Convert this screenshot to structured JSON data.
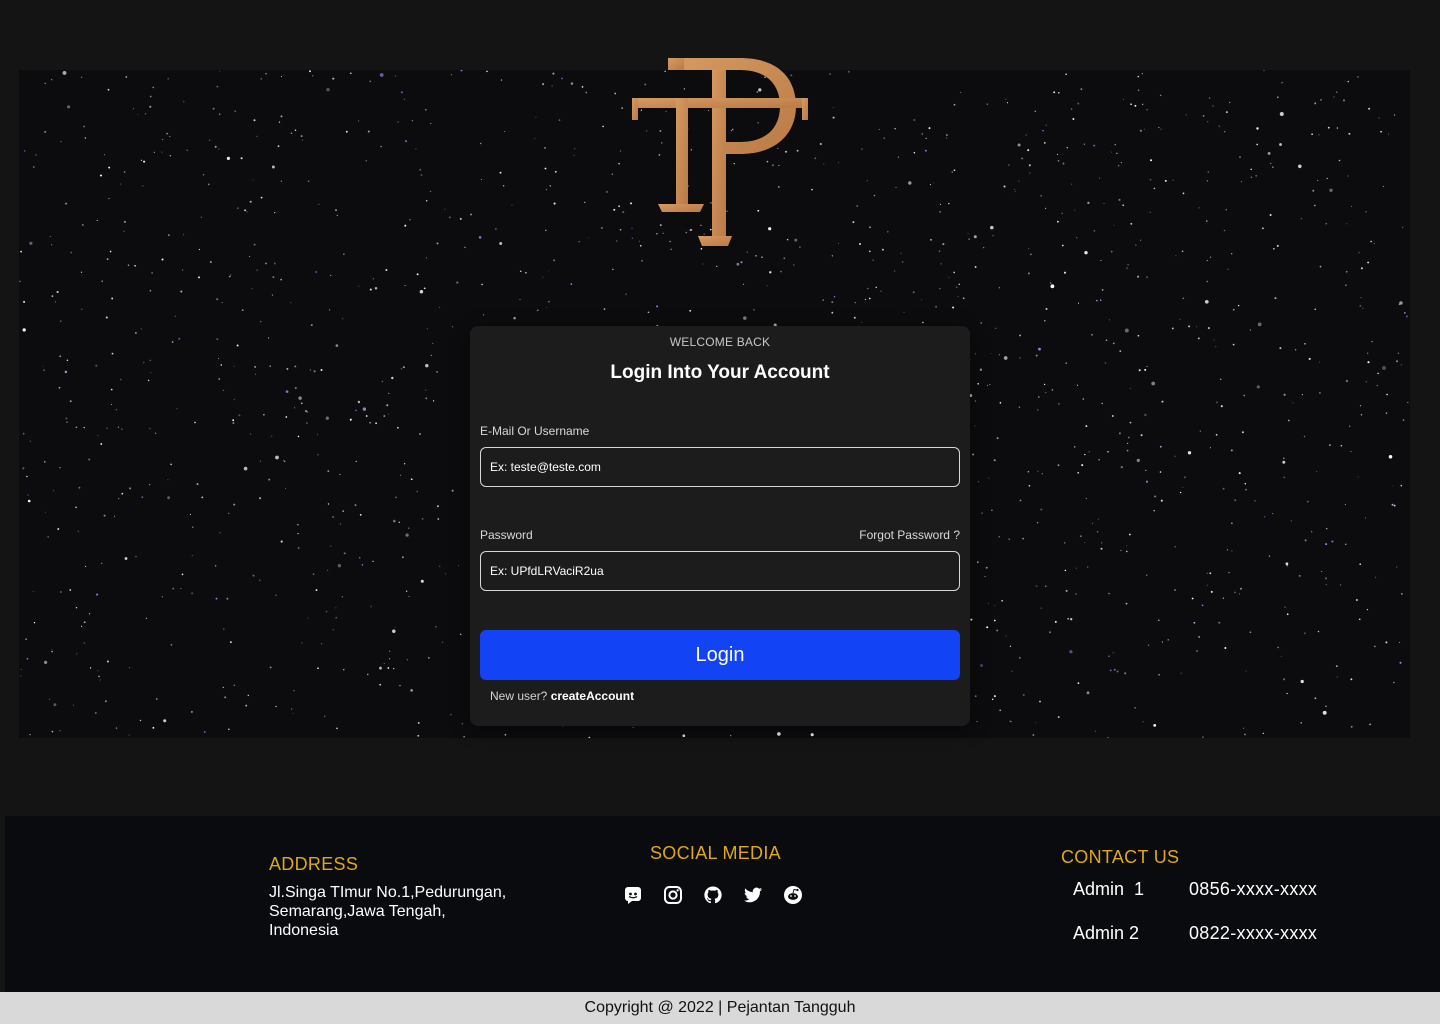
{
  "card": {
    "welcome": "WELCOME BACK",
    "title": "Login Into Your Account",
    "email_label": "E-Mail Or Username",
    "email_placeholder": "Ex: teste@teste.com",
    "password_label": "Password",
    "forgot_link": "Forgot Password ?",
    "password_placeholder": "Ex: UPfdLRVaciR2ua",
    "login_button": "Login",
    "new_user_text": "New user?",
    "create_account_link": "createAccount"
  },
  "footer": {
    "address_heading": "ADDRESS",
    "address_line1": "Jl.Singa TImur No.1,Pedurungan,",
    "address_line2": "Semarang,Jawa Tengah,",
    "address_line3": "Indonesia",
    "social_heading": "SOCIAL MEDIA",
    "social_icons": [
      "discord-icon",
      "instagram-icon",
      "github-icon",
      "twitter-icon",
      "reddit-icon"
    ],
    "contact_heading": "CONTACT US",
    "contacts": [
      {
        "name": "Admin  1",
        "phone": "0856-xxxx-xxxx"
      },
      {
        "name": "Admin 2",
        "phone": "0822-xxxx-xxxx"
      }
    ]
  },
  "copyright": "Copyright @ 2022 | Pejantan Tangguh",
  "colors": {
    "page_bg": "#141414",
    "card_bg": "#1c1c1d",
    "button": "#1243f5",
    "heading_gold": "#e0a818",
    "logo_bronze": "#c98a55",
    "footer_bg": "#0a0b0e",
    "copyright_bg": "#d9d9d9"
  }
}
